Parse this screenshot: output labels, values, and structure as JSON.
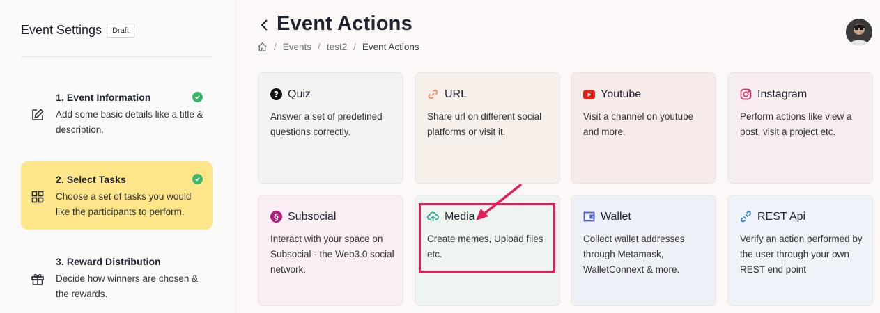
{
  "sidebar": {
    "title": "Event Settings",
    "badge": "Draft",
    "steps": [
      {
        "title": "1. Event Information",
        "desc": "Add some basic details like a title & description.",
        "completed": true,
        "icon": "edit-icon"
      },
      {
        "title": "2. Select Tasks",
        "desc": "Choose a set of tasks you would like the participants to perform.",
        "completed": true,
        "icon": "grid-icon"
      },
      {
        "title": "3. Reward Distribution",
        "desc": "Decide how winners are chosen & the rewards.",
        "completed": false,
        "icon": "gift-icon"
      }
    ]
  },
  "header": {
    "title": "Event Actions",
    "breadcrumb": [
      "Events",
      "test2",
      "Event Actions"
    ]
  },
  "cards": [
    {
      "title": "Quiz",
      "desc": "Answer a set of predefined questions correctly.",
      "icon": "question-icon",
      "color": "#111111"
    },
    {
      "title": "URL",
      "desc": "Share url on different social platforms or visit it.",
      "icon": "link-icon",
      "color": "#f08a5d"
    },
    {
      "title": "Youtube",
      "desc": "Visit a channel on youtube and more.",
      "icon": "youtube-icon",
      "color": "#e62117"
    },
    {
      "title": "Instagram",
      "desc": "Perform actions like view a post, visit a project etc.",
      "icon": "instagram-icon",
      "color": "#d6336c"
    },
    {
      "title": "Subsocial",
      "desc": "Interact with your space on Subsocial - the Web3.0 social network.",
      "icon": "subsocial-icon",
      "color": "#b5197d"
    },
    {
      "title": "Media",
      "desc": "Create memes, Upload files etc.",
      "icon": "cloud-upload-icon",
      "color": "#1aa489"
    },
    {
      "title": "Wallet",
      "desc": "Collect wallet addresses through Metamask, WalletConnext & more.",
      "icon": "wallet-icon",
      "color": "#4a5bd4"
    },
    {
      "title": "REST Api",
      "desc": "Verify an action performed by the user through your own REST end point",
      "icon": "api-icon",
      "color": "#2c86c9"
    }
  ],
  "colors": {
    "accent_yellow": "#fde68a",
    "check_green": "#3cb76a",
    "highlight": "#e41e5a"
  }
}
